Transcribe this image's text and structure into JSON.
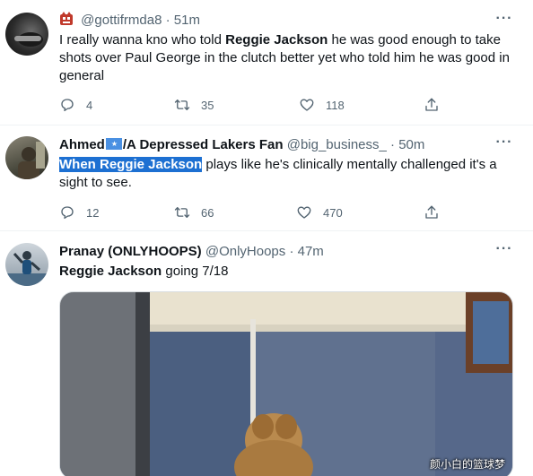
{
  "tweets": [
    {
      "display_name": "",
      "handle": "@gottifrmda8",
      "time": "51m",
      "text_parts": [
        {
          "t": "I really wanna kno who told ",
          "s": "n"
        },
        {
          "t": "Reggie Jackson",
          "s": "b"
        },
        {
          "t": " he was good enough to take shots over Paul George in the clutch better yet who told him he was good in general",
          "s": "n"
        }
      ],
      "replies": "4",
      "retweets": "35",
      "likes": "118"
    },
    {
      "display_name": "Ahmed",
      "display_name_suffix": "/A Depressed Lakers Fan",
      "handle": "@big_business_",
      "time": "50m",
      "text_highlight": "When Reggie Jackson",
      "text_rest": " plays like he's clinically mentally challenged it's a sight to see.",
      "replies": "12",
      "retweets": "66",
      "likes": "470"
    },
    {
      "display_name": "Pranay (ONLYHOOPS)",
      "handle": "@OnlyHoops",
      "time": "47m",
      "text_bold": "Reggie Jackson",
      "text_rest": " going 7/18"
    }
  ],
  "separator": "·",
  "more_icon": "more-dots-icon",
  "watermark": "颜小白的篮球梦",
  "colors": {
    "highlight": "#1d70d2",
    "muted": "#536471",
    "flag_blue": "#4a90e2",
    "badge_red": "#c0392b"
  }
}
